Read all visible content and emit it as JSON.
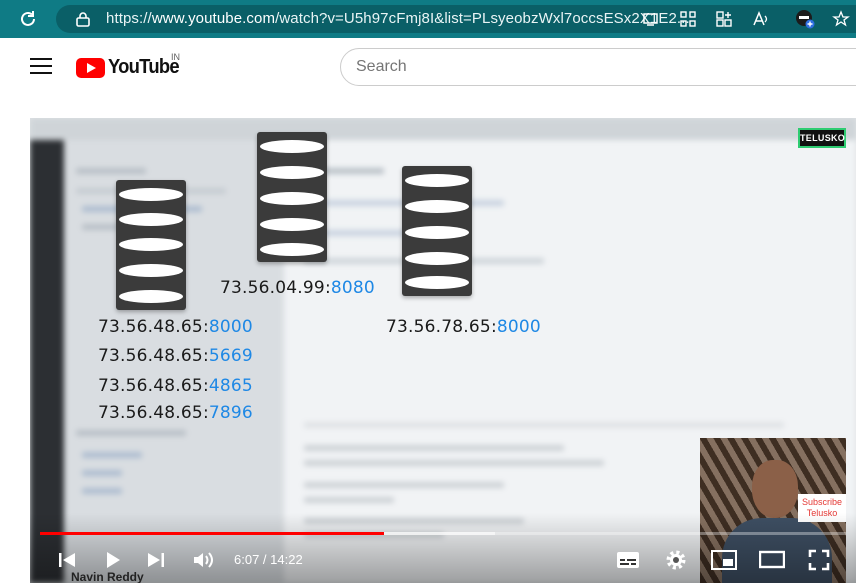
{
  "browser": {
    "url_prefix": "https://",
    "url_host": "www.youtube.com",
    "url_path": "/watch?v=U5h97cFmj8I&list=PLsyeobzWxl7occsESx2X1E2..."
  },
  "header": {
    "logo_text": "YouTube",
    "region": "IN",
    "search_placeholder": "Search"
  },
  "video": {
    "watermark": "TELUSKO",
    "servers": [
      {
        "ip": "73.56.48.65:",
        "port": "8000"
      },
      {
        "ip": "73.56.48.65:",
        "port": "5669"
      },
      {
        "ip": "73.56.48.65:",
        "port": "4865"
      },
      {
        "ip": "73.56.48.65:",
        "port": "7896"
      },
      {
        "ip": "73.56.04.99:",
        "port": "8080"
      },
      {
        "ip": "73.56.78.65:",
        "port": "8000"
      }
    ],
    "subscribe_line1": "Subscribe",
    "subscribe_line2": "Telusko",
    "channel_name": "Navin Reddy"
  },
  "player": {
    "current_time": "6:07",
    "separator": " / ",
    "duration": "14:22",
    "played_fraction": 0.427,
    "loaded_fraction": 0.565
  },
  "colors": {
    "browser_bar": "#0f7b85",
    "yt_red": "#ff0000",
    "port_blue": "#1e88e5"
  }
}
